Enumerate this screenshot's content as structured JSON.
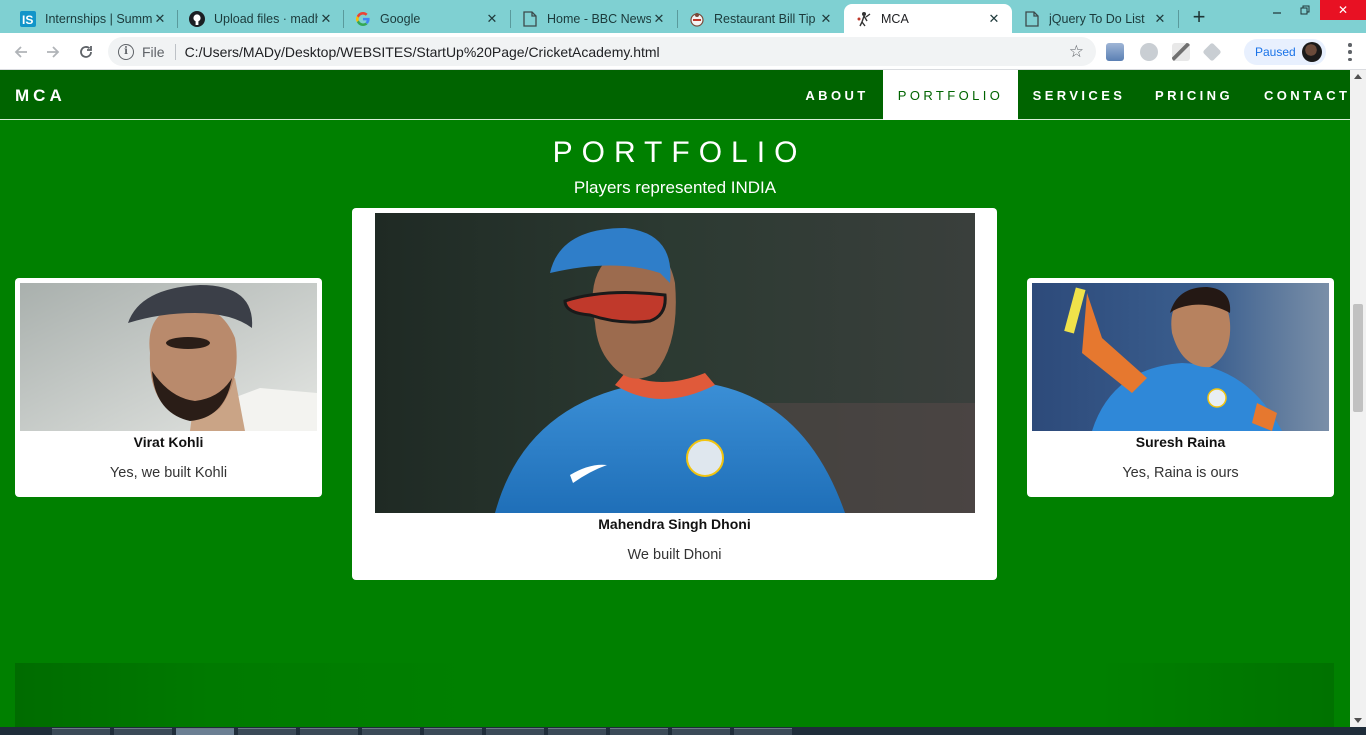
{
  "browser": {
    "tabs": [
      {
        "title": "Internships | Summ",
        "icon": "internshala-icon"
      },
      {
        "title": "Upload files · madh",
        "icon": "github-icon"
      },
      {
        "title": "Google",
        "icon": "google-icon"
      },
      {
        "title": "Home - BBC News",
        "icon": "page-icon"
      },
      {
        "title": "Restaurant Bill Tip C",
        "icon": "restaurant-icon"
      },
      {
        "title": "MCA",
        "icon": "cricket-icon",
        "active": true
      },
      {
        "title": "jQuery To Do List",
        "icon": "page-icon"
      }
    ],
    "address_scheme": "File",
    "address_url": "C:/Users/MADy/Desktop/WEBSITES/StartUp%20Page/CricketAcademy.html",
    "profile_status": "Paused"
  },
  "site": {
    "brand": "MCA",
    "nav": [
      "ABOUT",
      "PORTFOLIO",
      "SERVICES",
      "PRICING",
      "CONTACT"
    ],
    "active_nav": "PORTFOLIO"
  },
  "portfolio": {
    "title": "PORTFOLIO",
    "subtitle": "Players represented INDIA",
    "cards": [
      {
        "name": "Virat Kohli",
        "caption": "Yes, we built Kohli"
      },
      {
        "name": "Mahendra Singh Dhoni",
        "caption": "We built Dhoni"
      },
      {
        "name": "Suresh Raina",
        "caption": "Yes, Raina is ours"
      }
    ]
  },
  "colors": {
    "page_bg": "#008000",
    "navbar_bg": "#006400",
    "tabstrip_bg": "#7fd0d2",
    "card_bg": "#ffffff"
  }
}
